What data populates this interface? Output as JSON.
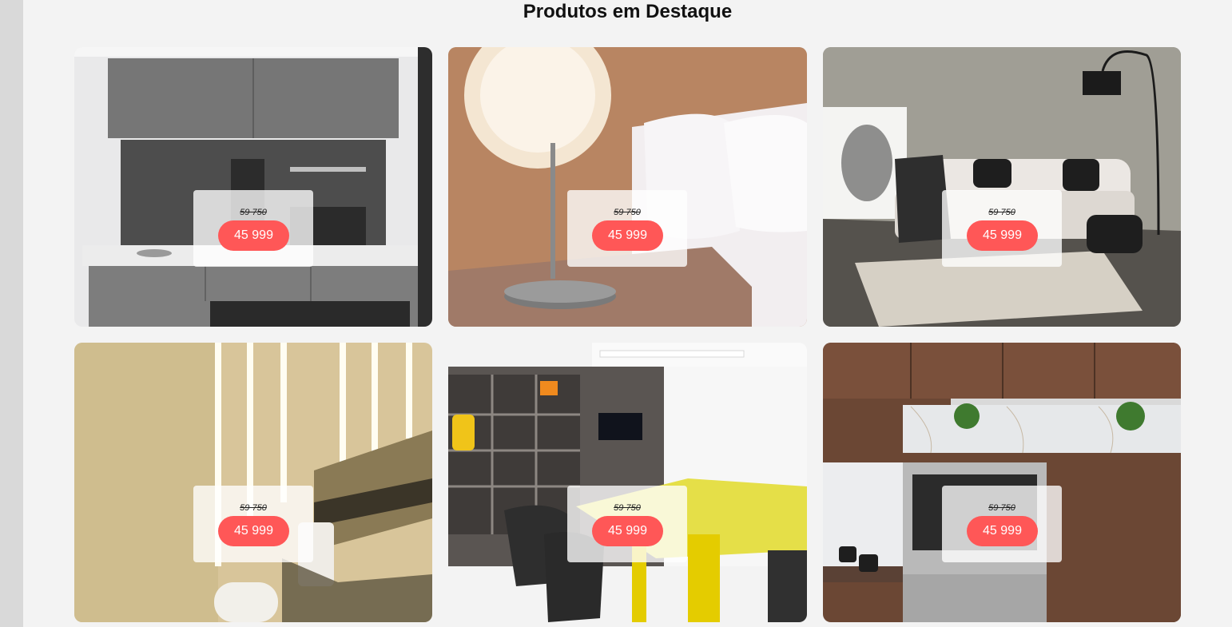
{
  "section": {
    "title": "Produtos em Destaque"
  },
  "products": [
    {
      "scene": "kitchenette-bar",
      "old_price": "59 750",
      "price": "45 999"
    },
    {
      "scene": "bedside-lamp",
      "old_price": "59 750",
      "price": "45 999"
    },
    {
      "scene": "living-room-sofa",
      "old_price": "59 750",
      "price": "45 999"
    },
    {
      "scene": "bathroom-led-strips",
      "old_price": "59 750",
      "price": "45 999"
    },
    {
      "scene": "office-yellow-table",
      "old_price": "59 750",
      "price": "45 999"
    },
    {
      "scene": "kitchen-oven",
      "old_price": "59 750",
      "price": "45 999"
    }
  ],
  "colors": {
    "price_badge": "#ff5757",
    "background": "#f3f3f3",
    "sidebar": "#d9d9d9"
  }
}
